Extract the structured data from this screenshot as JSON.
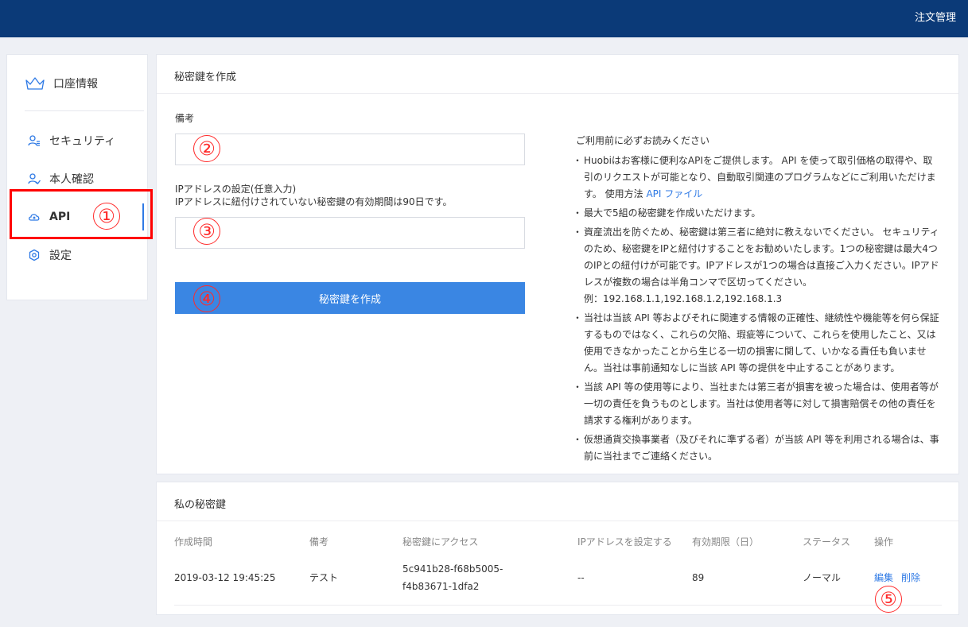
{
  "header": {
    "menu_label": "注文管理"
  },
  "sidebar": {
    "items": [
      {
        "label": "口座情報",
        "icon": "crown-icon"
      },
      {
        "label": "セキュリティ",
        "icon": "user-shield-icon"
      },
      {
        "label": "本人確認",
        "icon": "user-check-icon"
      },
      {
        "label": "API",
        "icon": "cloud-icon",
        "active": true
      },
      {
        "label": "設定",
        "icon": "gear-icon"
      }
    ]
  },
  "create_panel": {
    "title": "秘密鍵を作成",
    "note_label": "備考",
    "note_value": "",
    "ip_label_1": "IPアドレスの設定(任意入力)",
    "ip_label_2": "IPアドレスに紐付けされていない秘密鍵の有効期間は90日です。",
    "ip_value": "",
    "submit_label": "秘密鍵を作成"
  },
  "notice": {
    "head": "ご利用前に必ずお読みください",
    "item1_text": "Huobiはお客様に便利なAPIをご提供します。 API を使って取引価格の取得や、取引のリクエストが可能となり、自動取引関連のプログラムなどにご利用いただけます。 使用方法 ",
    "item1_link": "API ファイル",
    "item2": "最大で5組の秘密鍵を作成いただけます。",
    "item3": "資産流出を防ぐため、秘密鍵は第三者に絶対に教えないでください。 セキュリティのため、秘密鍵をIPと紐付けすることをお勧めいたします。1つの秘密鍵は最大4つのIPとの紐付けが可能です。IPアドレスが1つの場合は直接ご入力ください。IPアドレスが複数の場合は半角コンマで区切ってください。",
    "item3_example": "例：192.168.1.1,192.168.1.2,192.168.1.3",
    "item4": "当社は当該 API 等およびそれに関連する情報の正確性、継続性や機能等を何ら保証するものではなく、これらの欠陥、瑕疵等について、これらを使用したこと、又は使用できなかったことから生じる一切の損害に関して、いかなる責任も負いません。当社は事前通知なしに当該 API 等の提供を中止することがあります。",
    "item5": "当該 API 等の使用等により、当社または第三者が損害を被った場合は、使用者等が一切の責任を負うものとします。当社は使用者等に対して損害賠償その他の責任を請求する権利があります。",
    "item6": "仮想通貨交換事業者（及びそれに準ずる者）が当該 API 等を利用される場合は、事前に当社までご連絡ください。"
  },
  "keys_panel": {
    "title": "私の秘密鍵",
    "columns": [
      "作成時間",
      "備考",
      "秘密鍵にアクセス",
      "IPアドレスを設定する",
      "有効期限（日）",
      "ステータス",
      "操作"
    ],
    "rows": [
      {
        "created": "2019-03-12 19:45:25",
        "note": "テスト",
        "access_key_1": "5c941b28-f68b5005-",
        "access_key_2": "f4b83671-1dfa2",
        "ip": "--",
        "expiry": "89",
        "status": "ノーマル",
        "edit_label": "編集",
        "delete_label": "削除"
      }
    ]
  },
  "annotations": [
    "①",
    "②",
    "③",
    "④",
    "⑤"
  ],
  "colors": {
    "header_bg": "#0b3a78",
    "accent": "#2f7ae5",
    "button": "#3a86e3",
    "annotation": "#ff0000"
  }
}
